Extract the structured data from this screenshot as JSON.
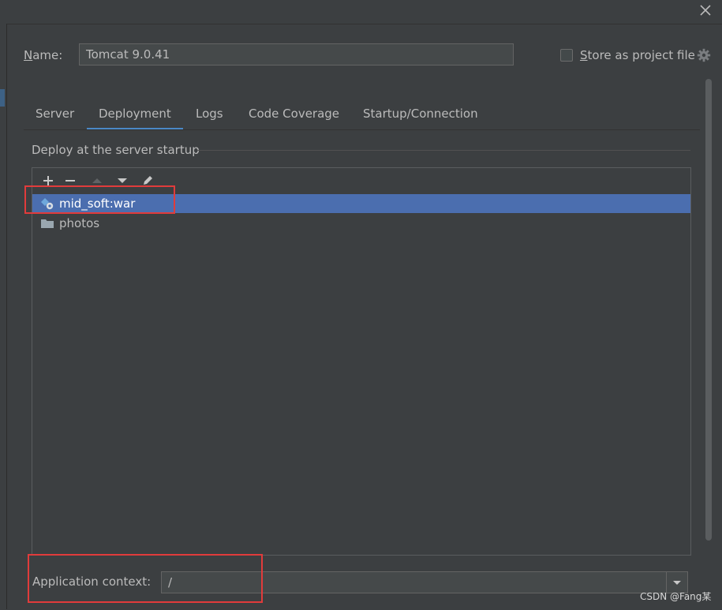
{
  "dialog": {
    "close_icon": "close-icon"
  },
  "name_field": {
    "label_first": "N",
    "label_rest": "ame:",
    "value": "Tomcat 9.0.41"
  },
  "store_option": {
    "label_first": "S",
    "label_rest": "tore as project file",
    "checked": false,
    "icon": "gear-icon"
  },
  "tabs": [
    {
      "label": "Server",
      "active": false
    },
    {
      "label": "Deployment",
      "active": true
    },
    {
      "label": "Logs",
      "active": false
    },
    {
      "label": "Code Coverage",
      "active": false
    },
    {
      "label": "Startup/Connection",
      "active": false
    }
  ],
  "deploy_section": {
    "title": "Deploy at the server startup",
    "toolbar": [
      "plus-icon",
      "minus-icon",
      "move-up-icon",
      "move-down-icon",
      "edit-icon"
    ],
    "items": [
      {
        "label": "mid_soft:war",
        "icon": "artifact-icon",
        "selected": true
      },
      {
        "label": "photos",
        "icon": "folder-icon",
        "selected": false
      }
    ]
  },
  "app_context": {
    "label": "Application context:",
    "value": "/"
  },
  "colors": {
    "accent": "#4a88c7",
    "selection": "#4b6eaf",
    "highlight": "#e13b3b",
    "background": "#3c3f41"
  },
  "watermark": "CSDN @Fang某"
}
